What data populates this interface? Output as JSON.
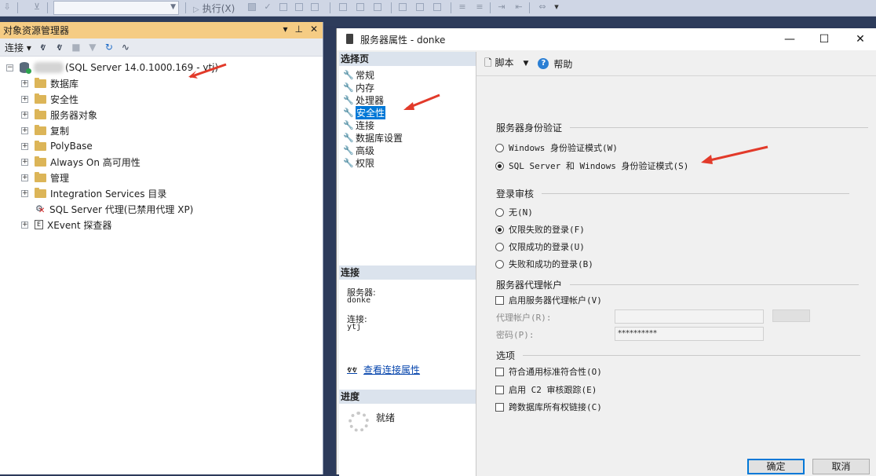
{
  "toolbar": {
    "execute_label": "执行(X)"
  },
  "object_explorer": {
    "title": "对象资源管理器",
    "connect_label": "连接",
    "server_node": "(SQL Server 14.0.1000.169",
    "server_node_suffix": "- ytj)",
    "nodes": [
      "数据库",
      "安全性",
      "服务器对象",
      "复制",
      "PolyBase",
      "Always On 高可用性",
      "管理",
      "Integration Services 目录",
      "SQL Server 代理(已禁用代理 XP)",
      "XEvent 探查器"
    ]
  },
  "dialog": {
    "title": "服务器属性 - donke",
    "select_page_header": "选择页",
    "pages": [
      "常规",
      "内存",
      "处理器",
      "安全性",
      "连接",
      "数据库设置",
      "高级",
      "权限"
    ],
    "connection_header": "连接",
    "server_label": "服务器:",
    "server_value": "donke",
    "connection_label": "连接:",
    "connection_value": "ytj",
    "view_connection_link": "查看连接属性",
    "progress_header": "进度",
    "progress_status": "就绪",
    "script_label": "脚本",
    "help_label": "帮助",
    "auth_section": "服务器身份验证",
    "auth_windows": "Windows 身份验证模式(W)",
    "auth_mixed": "SQL Server 和 Windows 身份验证模式(S)",
    "audit_section": "登录审核",
    "audit_none": "无(N)",
    "audit_failed": "仅限失败的登录(F)",
    "audit_success": "仅限成功的登录(U)",
    "audit_both": "失败和成功的登录(B)",
    "proxy_section": "服务器代理帐户",
    "proxy_enable": "启用服务器代理帐户(V)",
    "proxy_account_label": "代理帐户(R):",
    "password_label": "密码(P):",
    "password_value": "**********",
    "options_section": "选项",
    "opt_common_criteria": "符合通用标准符合性(O)",
    "opt_c2_audit": "启用 C2 审核跟踪(E)",
    "opt_cross_db": "跨数据库所有权链接(C)",
    "ok_label": "确定",
    "cancel_label": "取消"
  },
  "colors": {
    "title_bar_accent": "#f5cc84",
    "selection": "#0078d7",
    "annotation_arrow": "#e23a2a"
  }
}
